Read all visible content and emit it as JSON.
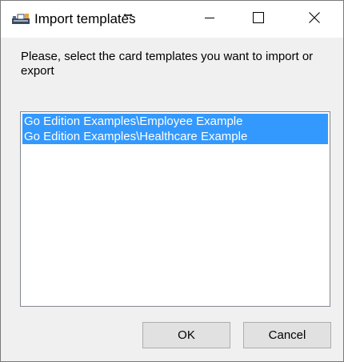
{
  "window": {
    "title": "Import templates"
  },
  "titlebar": {
    "icons": {
      "app": "card-printer-icon",
      "cursor": "resize-cursor-icon",
      "minimize": "minimize-icon",
      "maximize": "maximize-icon",
      "close": "close-icon"
    }
  },
  "dialog": {
    "prompt": "Please, select the card templates you want to import or export",
    "templates": [
      "Go Edition Examples\\Employee Example",
      "Go Edition Examples\\Healthcare Example"
    ],
    "ok_label": "OK",
    "cancel_label": "Cancel"
  },
  "colors": {
    "selection": "#3399ff",
    "window_bg": "#f0f0f0",
    "button_bg": "#e1e1e1"
  }
}
